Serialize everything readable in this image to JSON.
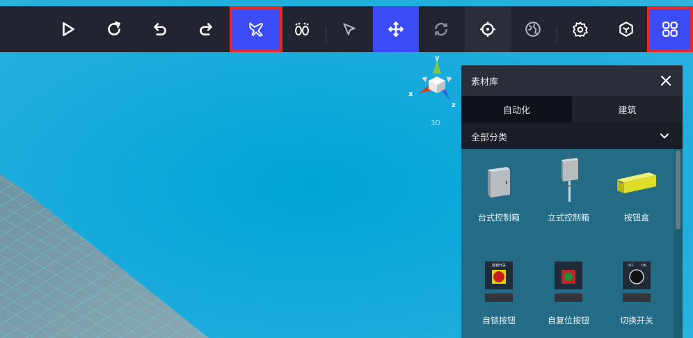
{
  "toolbar": {
    "buttons": [
      {
        "name": "play-icon"
      },
      {
        "name": "refresh-icon"
      },
      {
        "name": "undo-icon"
      },
      {
        "name": "redo-icon"
      },
      {
        "name": "fly-mode-icon"
      },
      {
        "name": "walk-mode-icon"
      },
      {
        "name": "select-pointer-icon"
      },
      {
        "name": "move-icon"
      },
      {
        "name": "rotate-icon"
      },
      {
        "name": "crosshair-icon"
      },
      {
        "name": "globe-icon"
      },
      {
        "name": "settings-icon"
      },
      {
        "name": "cube-icon"
      },
      {
        "name": "library-grid-icon"
      }
    ],
    "active_color": "#3b4cf7",
    "highlight_color": "#ea2828"
  },
  "axis_gizmo": {
    "x": "x",
    "y": "y",
    "z": "z",
    "mode": "3D"
  },
  "panel": {
    "title": "素材库",
    "tabs": [
      {
        "label": "自动化"
      },
      {
        "label": "建筑"
      }
    ],
    "category": "全部分类",
    "items": [
      {
        "label": "台式控制箱",
        "icon": "desk-control-box-icon"
      },
      {
        "label": "立式控制箱",
        "icon": "standing-control-box-icon"
      },
      {
        "label": "按钮盒",
        "icon": "button-box-icon"
      },
      {
        "label": "自锁按钮",
        "icon": "self-lock-button-icon"
      },
      {
        "label": "自复位按钮",
        "icon": "self-reset-button-icon"
      },
      {
        "label": "切换开关",
        "icon": "toggle-switch-icon"
      }
    ]
  }
}
